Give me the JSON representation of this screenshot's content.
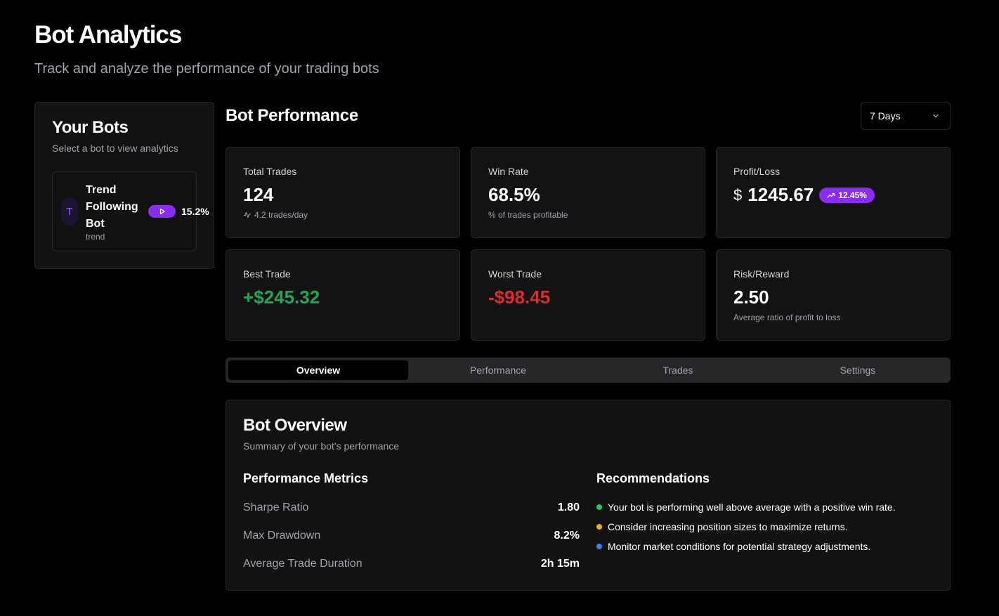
{
  "header": {
    "title": "Bot Analytics",
    "subtitle": "Track and analyze the performance of your trading bots"
  },
  "sidebar": {
    "title": "Your Bots",
    "subtitle": "Select a bot to view analytics",
    "bots": [
      {
        "initial": "T",
        "name": "Trend Following Bot",
        "type": "trend",
        "return": "15.2%",
        "status_icon": "play-icon"
      }
    ]
  },
  "performance": {
    "title": "Bot Performance",
    "range": {
      "selected": "7 Days",
      "icon": "chevron-down-icon"
    }
  },
  "stats": {
    "total_trades": {
      "label": "Total Trades",
      "value": "124",
      "note": "4.2 trades/day",
      "icon": "activity-icon"
    },
    "win_rate": {
      "label": "Win Rate",
      "value": "68.5%",
      "note": "% of trades profitable"
    },
    "profit_loss": {
      "label": "Profit/Loss",
      "currency": "$",
      "value": "1245.67",
      "badge": "12.45%",
      "badge_icon": "trending-up-icon"
    },
    "best_trade": {
      "label": "Best Trade",
      "value": "+$245.32"
    },
    "worst_trade": {
      "label": "Worst Trade",
      "value": "-$98.45"
    },
    "risk_reward": {
      "label": "Risk/Reward",
      "value": "2.50",
      "note": "Average ratio of profit to loss"
    }
  },
  "tabs": [
    {
      "label": "Overview",
      "active": true
    },
    {
      "label": "Performance",
      "active": false
    },
    {
      "label": "Trades",
      "active": false
    },
    {
      "label": "Settings",
      "active": false
    }
  ],
  "overview": {
    "title": "Bot Overview",
    "subtitle": "Summary of your bot's performance",
    "metrics_title": "Performance Metrics",
    "metrics": [
      {
        "label": "Sharpe Ratio",
        "value": "1.80"
      },
      {
        "label": "Max Drawdown",
        "value": "8.2%"
      },
      {
        "label": "Average Trade Duration",
        "value": "2h 15m"
      }
    ],
    "recommendations_title": "Recommendations",
    "recommendations": [
      {
        "text": "Your bot is performing well above average with a positive win rate.",
        "color": "#22c55e"
      },
      {
        "text": "Consider increasing position sizes to maximize returns.",
        "color": "#eab308"
      },
      {
        "text": "Monitor market conditions for potential strategy adjustments.",
        "color": "#3b82f6"
      }
    ]
  },
  "colors": {
    "background": "#000000",
    "card": "#131313",
    "border": "#27272a",
    "accent": "#8b2cf5",
    "positive": "#22a559",
    "negative": "#dc2c2c",
    "muted": "#a1a1aa"
  }
}
